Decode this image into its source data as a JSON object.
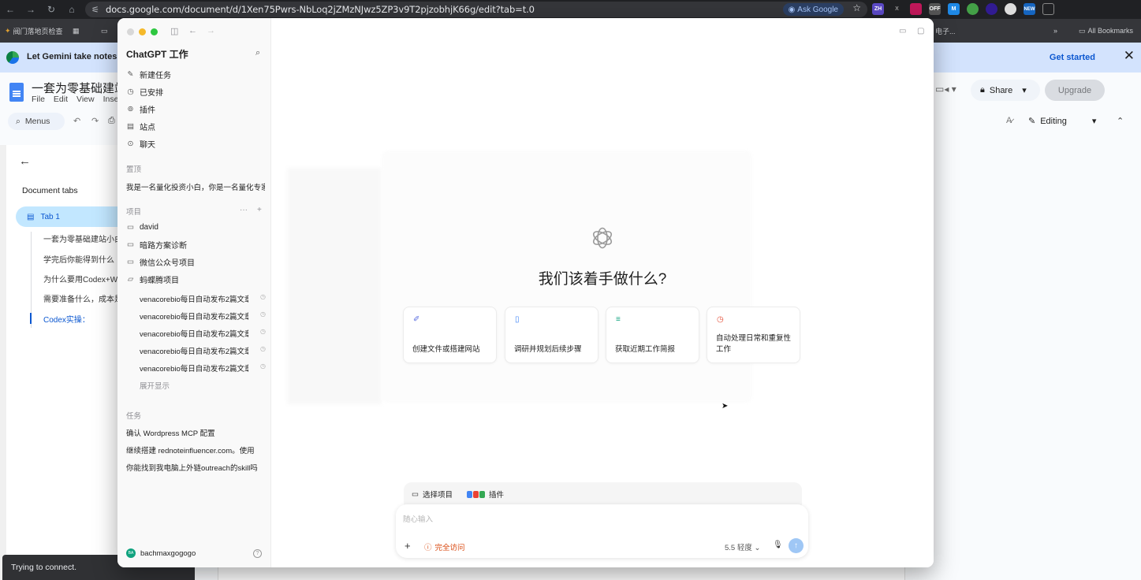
{
  "browser": {
    "url": "docs.google.com/document/d/1Xen75Pwrs-NbLoq2jZMzNJwz5ZP3v9T2pjzobhjK66g/edit?tab=t.0",
    "ask_google": "Ask Google",
    "bookmarks": {
      "first": "阀门落地页检查",
      "right": "电子...",
      "all": "All Bookmarks"
    },
    "ext_labels": [
      "ZH",
      "X",
      "",
      "OFF",
      "M",
      "",
      "",
      "",
      "NEW"
    ]
  },
  "gemini_banner": {
    "text": "Let Gemini take notes fo",
    "action": "Get started"
  },
  "docs": {
    "title": "一套为零基础建站小",
    "menu": [
      "File",
      "Edit",
      "View",
      "Inse"
    ],
    "menus_label": "Menus",
    "share": "Share",
    "upgrade": "Upgrade",
    "editing": "Editing",
    "sidebar_title": "Document tabs",
    "tab1": "Tab 1",
    "outline": [
      "一套为零基础建站小白",
      "学完后你能得到什么",
      "为什么要用Codex+W",
      "需要准备什么，成本是",
      "Codex实操："
    ],
    "toast": "Trying to connect."
  },
  "app": {
    "title": "ChatGPT 工作",
    "nav": [
      {
        "icon": "✎",
        "label": "新建任务"
      },
      {
        "icon": "◷",
        "label": "已安排"
      },
      {
        "icon": "⊚",
        "label": "插件"
      },
      {
        "icon": "▤",
        "label": "站点"
      },
      {
        "icon": "⊙",
        "label": "聊天"
      }
    ],
    "pinned_label": "置顶",
    "pinned_item": "我是一名量化投资小白，你是一名量化专家",
    "projects_label": "项目",
    "projects": [
      "david",
      "暗路方案诊断",
      "微信公众号项目",
      "蚂蝶腾项目"
    ],
    "sub_items": [
      "venacorebio每日自动发布2篇文章",
      "venacorebio每日自动发布2篇文章",
      "venacorebio每日自动发布2篇文章",
      "venacorebio每日自动发布2篇文章",
      "venacorebio每日自动发布2篇文章"
    ],
    "expand": "展开显示",
    "tasks_label": "任务",
    "tasks": [
      "确认 Wordpress MCP 配置",
      "继续搭建 rednoteinfluencer.com。使用",
      "你能找到我电脑上外链outreach的skill吗"
    ],
    "user": "bachmaxgogogo",
    "avatar_initials": "BA"
  },
  "main": {
    "headline": "我们该着手做什么?",
    "cards": [
      {
        "label": "创建文件或搭建网站",
        "icon": "wand-icon",
        "color": "#5b6ee1"
      },
      {
        "label": "调研并规划后续步骤",
        "icon": "book-icon",
        "color": "#3b82f6"
      },
      {
        "label": "获取近期工作简报",
        "icon": "list-icon",
        "color": "#10a37f"
      },
      {
        "label": "自动处理日常和重复性工作",
        "icon": "clock-icon",
        "color": "#e5533d"
      }
    ],
    "select_project": "选择项目",
    "plugins": "插件",
    "placeholder": "随心输入",
    "access": "完全访问",
    "model": "5.5 轻度"
  }
}
